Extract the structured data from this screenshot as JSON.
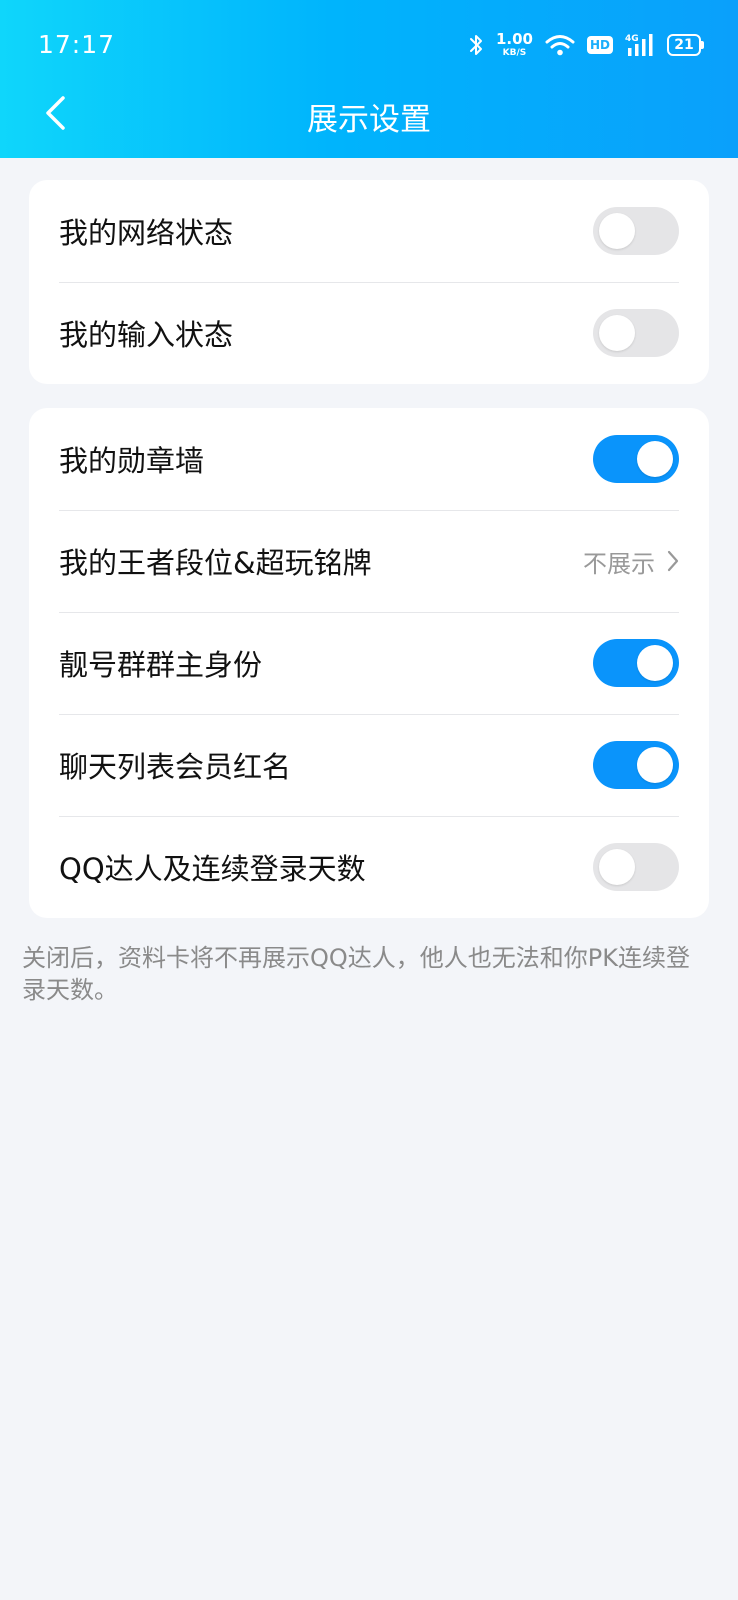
{
  "status_bar": {
    "time": "17:17",
    "net_speed_value": "1.00",
    "net_speed_unit": "KB/S",
    "hd_badge": "HD",
    "signal_label": "4G",
    "battery": "21",
    "icons": [
      "bluetooth-icon",
      "wifi-icon",
      "cellular-signal-icon",
      "battery-icon"
    ]
  },
  "nav": {
    "title": "展示设置",
    "back_icon": "chevron-left-icon"
  },
  "group1": {
    "items": [
      {
        "label": "我的网络状态",
        "type": "toggle",
        "on": false
      },
      {
        "label": "我的输入状态",
        "type": "toggle",
        "on": false
      }
    ]
  },
  "group2": {
    "items": [
      {
        "label": "我的勋章墙",
        "type": "toggle",
        "on": true
      },
      {
        "label": "我的王者段位&超玩铭牌",
        "type": "link",
        "value": "不展示"
      },
      {
        "label": "靓号群群主身份",
        "type": "toggle",
        "on": true
      },
      {
        "label": "聊天列表会员红名",
        "type": "toggle",
        "on": true
      },
      {
        "label": "QQ达人及连续登录天数",
        "type": "toggle",
        "on": false
      }
    ]
  },
  "footer_note": "关闭后，资料卡将不再展示QQ达人，他人也无法和你PK连续登录天数。",
  "colors": {
    "header_gradient_start": "#0fd6fb",
    "header_gradient_end": "#0aa0fb",
    "toggle_on": "#0a94fb",
    "toggle_off": "#e5e5e7",
    "background": "#f3f5f9"
  }
}
